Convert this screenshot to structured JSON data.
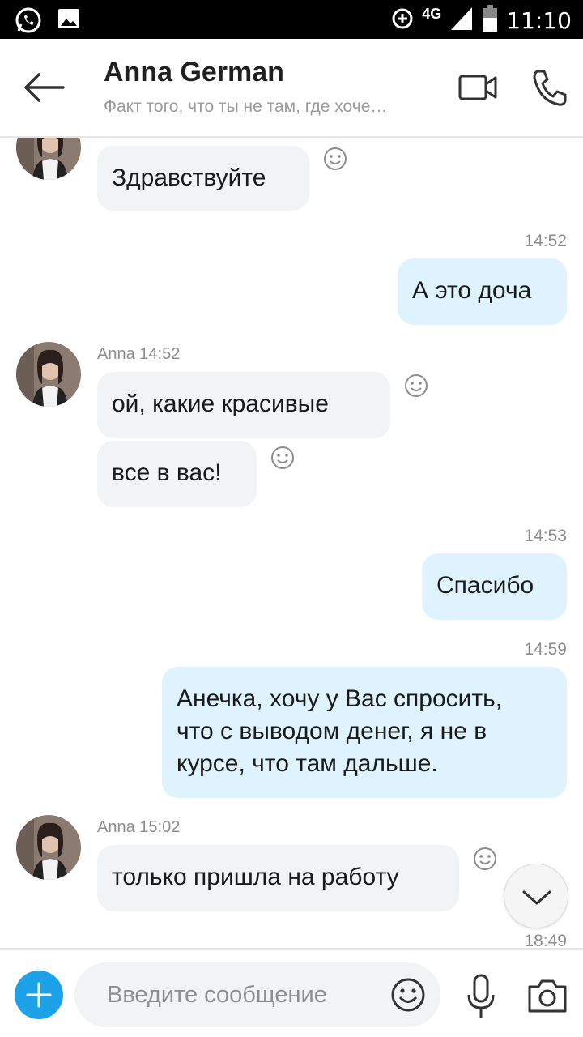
{
  "status_bar": {
    "network": "4G",
    "time": "11:10",
    "icons": [
      "whatsapp-icon",
      "gallery-icon",
      "data-saver-icon",
      "signal-icon",
      "battery-icon"
    ]
  },
  "header": {
    "title": "Anna German",
    "subtitle": "Факт того, что ты не там, где хоче…",
    "icons": [
      "back-arrow-icon",
      "video-call-icon",
      "phone-call-icon"
    ]
  },
  "messages": {
    "m1": {
      "text": "Здравствуйте"
    },
    "t2": "14:52",
    "m2": {
      "text": "А это доча"
    },
    "g3": {
      "sender": "Anna",
      "time": "14:52"
    },
    "m3": {
      "text": "ой, какие красивые"
    },
    "m4": {
      "text": "все в вас!"
    },
    "t5": "14:53",
    "m5": {
      "text": "Спасибо"
    },
    "t6": "14:59",
    "m6": {
      "lines": [
        "Анечка, хочу у Вас спросить,",
        "что с выводом денег, я не в",
        "курсе, что там дальше."
      ]
    },
    "g7": {
      "sender": "Anna",
      "time": "15:02"
    },
    "m7": {
      "text": "только пришла на работу"
    },
    "t8": "18:49"
  },
  "composer": {
    "placeholder": "Введите сообщение",
    "icons": [
      "plus-icon",
      "emoji-icon",
      "microphone-icon",
      "camera-icon"
    ]
  },
  "colors": {
    "incoming_bubble": "#f1f3f5",
    "outgoing_bubble": "#def3fd",
    "accent": "#1da1e8"
  }
}
